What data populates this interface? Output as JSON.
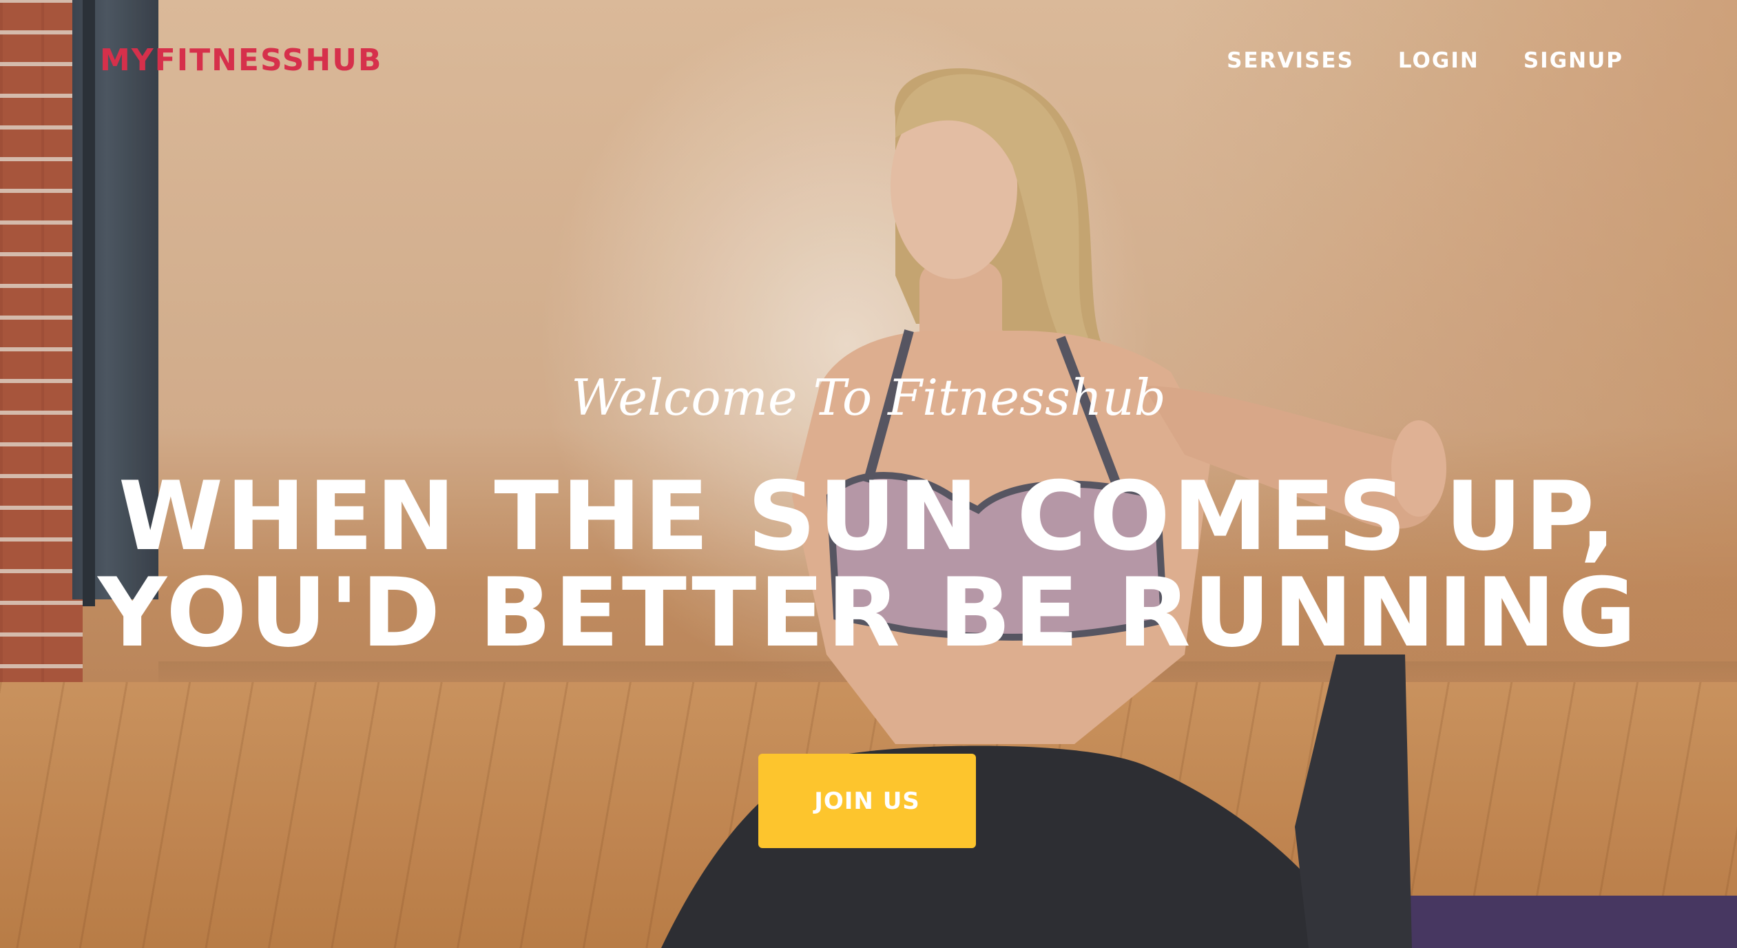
{
  "brand": {
    "logo_text": "MYFITNESSHUB",
    "logo_color": "#d6304b"
  },
  "nav": {
    "items": [
      {
        "label": "SERVISES"
      },
      {
        "label": "LOGIN"
      },
      {
        "label": "SIGNUP"
      }
    ]
  },
  "hero": {
    "welcome": "Welcome To Fitnesshub",
    "headline_line1": "WHEN THE SUN COMES UP,",
    "headline_line2": "YOU'D BETTER BE RUNNING",
    "cta_label": "JOIN US",
    "cta_color": "#fdc52d",
    "background_image": "woman-yoga-photo"
  }
}
